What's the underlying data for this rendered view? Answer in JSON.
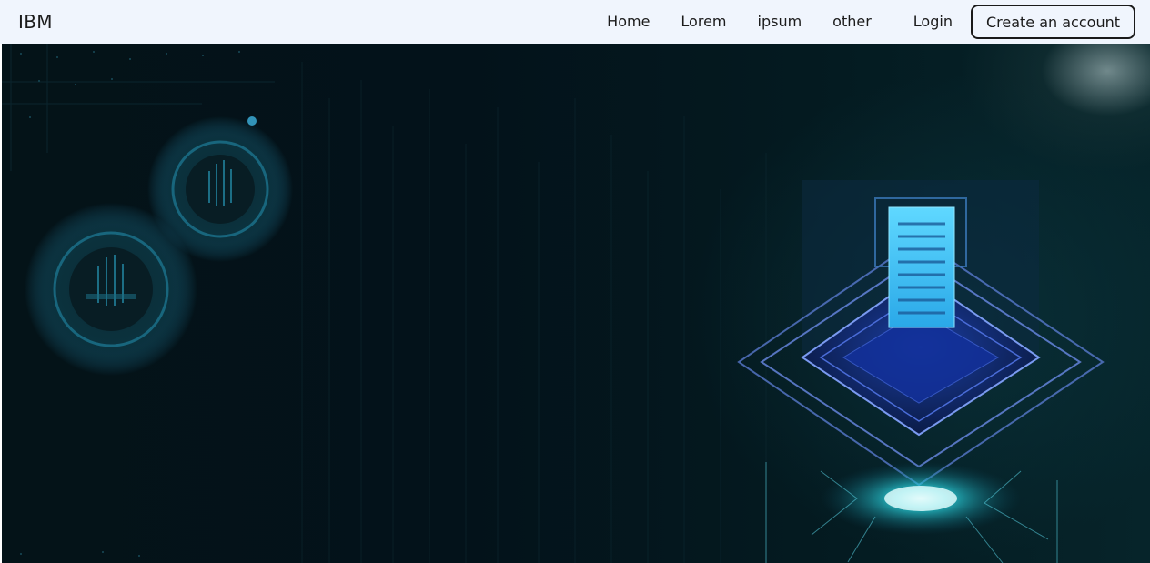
{
  "navbar": {
    "brand": "IBM",
    "links": [
      {
        "label": "Home"
      },
      {
        "label": "Lorem"
      },
      {
        "label": "ipsum"
      },
      {
        "label": "other"
      }
    ],
    "login_label": "Login",
    "cta_label": "Create an account"
  },
  "hero": {
    "image": "technology-circuit-illustration",
    "colors": {
      "background": "#041318",
      "glow": "#2ee6f0",
      "accent": "#3b7dff"
    }
  }
}
